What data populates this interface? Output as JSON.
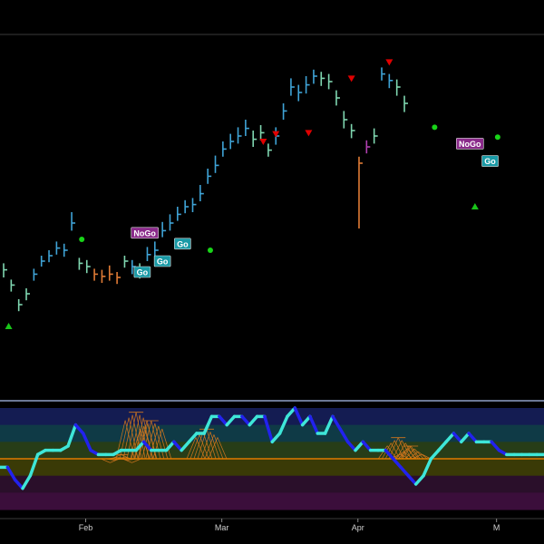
{
  "colors": {
    "background": "#000000",
    "bar_strong_up": "#3fa3d6",
    "bar_weak_up": "#7fd6b0",
    "bar_neutral": "#e07b35",
    "bar_down": "#b040b0",
    "marker_up_triangle": "#19c419",
    "marker_dot": "#18d418",
    "marker_down_triangle": "#e00000",
    "tag_go": "#1a9aa6",
    "tag_nogo": "#8a2a8a",
    "osc_up": "#3ee6d8",
    "osc_down": "#2222ee",
    "zero_line": "#e07b00",
    "cross_hatch": "#d2761d",
    "band_top": "#141c52",
    "band_2": "#0f3a46",
    "band_3": "#273d18",
    "band_4": "#3a3a06",
    "band_5": "#2a0f2a",
    "band_6": "#3b0e3b"
  },
  "chart_data": [
    {
      "type": "line",
      "panel": "price",
      "bar_style": "ohlc",
      "x": [
        0,
        3,
        6,
        9,
        12,
        15,
        18,
        21,
        24,
        27,
        30,
        33,
        36,
        39,
        42,
        45,
        48,
        51,
        54,
        57,
        60,
        63,
        66,
        69,
        72,
        75,
        78,
        81,
        84,
        87,
        90,
        93,
        96,
        99,
        102,
        105,
        108,
        111,
        114,
        117,
        120,
        123,
        126,
        129,
        132,
        135,
        138,
        141,
        144,
        147,
        150,
        153,
        156,
        159
      ],
      "close": [
        52,
        38,
        20,
        30,
        48,
        60,
        65,
        72,
        70,
        95,
        58,
        55,
        48,
        46,
        48,
        45,
        60,
        55,
        50,
        66,
        70,
        88,
        95,
        103,
        110,
        112,
        122,
        138,
        148,
        163,
        170,
        175,
        182,
        172,
        178,
        162,
        175,
        198,
        220,
        215,
        222,
        230,
        228,
        225,
        210,
        190,
        180,
        150,
        165,
        175,
        232,
        226,
        220,
        205
      ],
      "high": [
        58,
        43,
        25,
        35,
        53,
        65,
        70,
        78,
        76,
        105,
        63,
        61,
        53,
        52,
        56,
        50,
        65,
        61,
        58,
        73,
        78,
        96,
        103,
        110,
        116,
        118,
        130,
        145,
        157,
        170,
        177,
        183,
        190,
        180,
        185,
        168,
        183,
        205,
        228,
        222,
        230,
        236,
        234,
        232,
        217,
        198,
        186,
        156,
        171,
        182,
        238,
        232,
        227,
        212
      ],
      "low": [
        45,
        32,
        14,
        24,
        42,
        55,
        59,
        66,
        64,
        88,
        52,
        49,
        42,
        40,
        42,
        39,
        54,
        48,
        44,
        60,
        64,
        82,
        88,
        97,
        104,
        105,
        115,
        131,
        141,
        156,
        163,
        168,
        175,
        165,
        171,
        156,
        167,
        190,
        212,
        207,
        214,
        223,
        221,
        218,
        203,
        182,
        173,
        90,
        159,
        168,
        226,
        219,
        212,
        197
      ],
      "regime": [
        "weak_up",
        "weak_up",
        "weak_up",
        "weak_up",
        "strong_up",
        "strong_up",
        "strong_up",
        "strong_up",
        "strong_up",
        "strong_up",
        "weak_up",
        "weak_up",
        "neutral",
        "neutral",
        "neutral",
        "neutral",
        "weak_up",
        "strong_up",
        "weak_up",
        "strong_up",
        "strong_up",
        "strong_up",
        "strong_up",
        "strong_up",
        "strong_up",
        "strong_up",
        "strong_up",
        "strong_up",
        "strong_up",
        "strong_up",
        "strong_up",
        "strong_up",
        "strong_up",
        "weak_up",
        "weak_up",
        "weak_up",
        "strong_up",
        "strong_up",
        "strong_up",
        "strong_up",
        "strong_up",
        "strong_up",
        "weak_up",
        "weak_up",
        "weak_up",
        "weak_up",
        "weak_up",
        "neutral",
        "down",
        "weak_up",
        "strong_up",
        "strong_up",
        "weak_up",
        "weak_up"
      ],
      "markers": [
        {
          "kind": "up_triangle",
          "x": 2,
          "y": 0
        },
        {
          "kind": "dot",
          "x": 31,
          "y": 80
        },
        {
          "kind": "dot",
          "x": 64,
          "y": 60
        },
        {
          "kind": "dot",
          "x": 82,
          "y": 70
        },
        {
          "kind": "down_triangle",
          "x": 103,
          "y": 170
        },
        {
          "kind": "down_triangle",
          "x": 108,
          "y": 177
        },
        {
          "kind": "down_triangle",
          "x": 121,
          "y": 178
        },
        {
          "kind": "down_triangle",
          "x": 138,
          "y": 228
        },
        {
          "kind": "down_triangle",
          "x": 153,
          "y": 243
        },
        {
          "kind": "dot",
          "x": 171,
          "y": 183
        },
        {
          "kind": "up_triangle",
          "x": 187,
          "y": 110
        },
        {
          "kind": "dot",
          "x": 196,
          "y": 174
        }
      ],
      "tags": [
        {
          "text": "NoGo",
          "style": "nogo",
          "x": 56,
          "y": 86
        },
        {
          "text": "Go",
          "style": "go",
          "x": 71,
          "y": 76
        },
        {
          "text": "Go",
          "style": "go",
          "x": 55,
          "y": 50
        },
        {
          "text": "Go",
          "style": "go",
          "x": 63,
          "y": 60
        },
        {
          "text": "NoGo",
          "style": "nogo",
          "x": 185,
          "y": 168
        },
        {
          "text": "Go",
          "style": "go",
          "x": 193,
          "y": 152
        }
      ]
    },
    {
      "type": "line",
      "panel": "oscillator",
      "zero": 0,
      "ylim": [
        -6,
        6
      ],
      "x": [
        0,
        3,
        6,
        9,
        12,
        15,
        18,
        21,
        24,
        27,
        30,
        33,
        36,
        39,
        42,
        45,
        48,
        51,
        54,
        57,
        60,
        63,
        66,
        69,
        72,
        75,
        78,
        81,
        84,
        87,
        90,
        93,
        96,
        99,
        102,
        105,
        108,
        111,
        114,
        117,
        120,
        123,
        126,
        129,
        132,
        135,
        138,
        141,
        144,
        147,
        150,
        153,
        156,
        159,
        162,
        165,
        168,
        171,
        174,
        177,
        180,
        183,
        186,
        189,
        192,
        195,
        198,
        201,
        204,
        207,
        210,
        213,
        216
      ],
      "values": [
        -1,
        -1,
        -2.5,
        -3.5,
        -2,
        0.5,
        1,
        1,
        1,
        1.5,
        4,
        3,
        1,
        0.5,
        0.5,
        0.5,
        1,
        1,
        1,
        2,
        1,
        1,
        1,
        2,
        1,
        2,
        3,
        3,
        5,
        5,
        4,
        5,
        5,
        4,
        5,
        5,
        2,
        3,
        5,
        6,
        4,
        5,
        3,
        3,
        5,
        3.5,
        2,
        1,
        2,
        1,
        1,
        1,
        0,
        -1,
        -2,
        -3,
        -2,
        0,
        1,
        2,
        3,
        2,
        3,
        2,
        2,
        2,
        1,
        0.5,
        0.5,
        0.5,
        0.5,
        0.5,
        0.5
      ],
      "hatch_peaks": [
        {
          "x": 48,
          "y": 0.5
        },
        {
          "x": 54,
          "y": 5.5
        },
        {
          "x": 60,
          "y": 4.5
        },
        {
          "x": 82,
          "y": 3.5
        },
        {
          "x": 158,
          "y": 2.5
        },
        {
          "x": 163,
          "y": 1.5
        }
      ],
      "bands": [
        "band_top",
        "band_2",
        "band_3",
        "band_4",
        "band_5",
        "band_6"
      ]
    }
  ],
  "x_axis": {
    "ticks": [
      {
        "label": "Feb",
        "x": 34
      },
      {
        "label": "Mar",
        "x": 88
      },
      {
        "label": "Apr",
        "x": 142
      },
      {
        "label": "M",
        "x": 197
      }
    ]
  }
}
